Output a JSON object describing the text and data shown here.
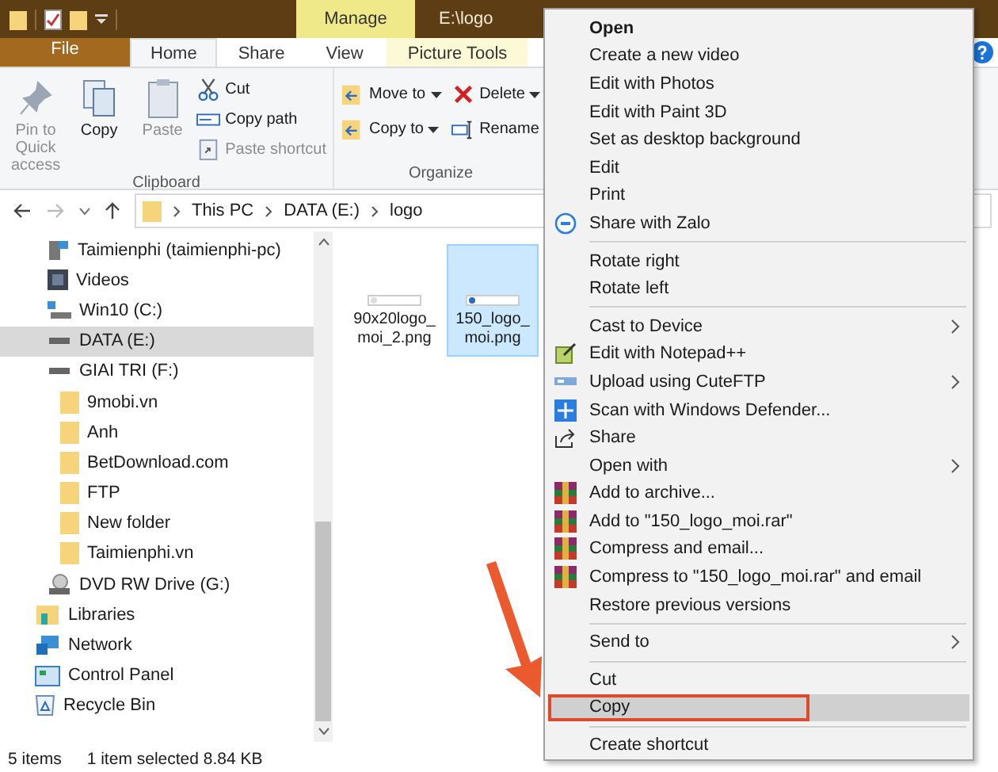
{
  "window": {
    "title": "E:\\logo",
    "context_tab": "Manage"
  },
  "tabs": [
    {
      "label": "File",
      "kind": "file",
      "selected": false
    },
    {
      "label": "Home",
      "kind": "normal",
      "selected": true
    },
    {
      "label": "Share",
      "kind": "normal",
      "selected": false
    },
    {
      "label": "View",
      "kind": "normal",
      "selected": false
    },
    {
      "label": "Picture Tools",
      "kind": "context",
      "selected": false
    }
  ],
  "ribbon": {
    "groups": [
      {
        "label": "Clipboard",
        "large_buttons": [
          {
            "label": "Pin to Quick access",
            "kind": "pin",
            "disabled": true
          },
          {
            "label": "Copy",
            "kind": "copy",
            "disabled": false
          },
          {
            "label": "Paste",
            "kind": "paste",
            "disabled": true
          }
        ],
        "small_buttons": [
          {
            "label": "Cut",
            "kind": "cut",
            "disabled": false,
            "dropdown": false
          },
          {
            "label": "Copy path",
            "kind": "copypath",
            "disabled": false,
            "dropdown": false
          },
          {
            "label": "Paste shortcut",
            "kind": "pasteshortcut",
            "disabled": true,
            "dropdown": false
          }
        ]
      },
      {
        "label": "Organize",
        "small_buttons": [
          {
            "label": "Move to",
            "kind": "moveto",
            "disabled": false,
            "dropdown": true
          },
          {
            "label": "Copy to",
            "kind": "copyto",
            "disabled": false,
            "dropdown": true
          },
          {
            "label": "Delete",
            "kind": "delete",
            "disabled": false,
            "dropdown": true
          },
          {
            "label": "Rename",
            "kind": "rename",
            "disabled": false,
            "dropdown": false
          }
        ]
      }
    ]
  },
  "address": {
    "path": [
      "This PC",
      "DATA (E:)",
      "logo"
    ]
  },
  "nav": {
    "items": [
      {
        "label": "Taimienphi (taimienphi-pc)",
        "kind": "netpc",
        "selected": false
      },
      {
        "label": "Videos",
        "kind": "videos",
        "selected": false
      },
      {
        "label": "Win10 (C:)",
        "kind": "windrive",
        "selected": false
      },
      {
        "label": "DATA (E:)",
        "kind": "drive",
        "selected": true
      },
      {
        "label": "GIAI TRI (F:)",
        "kind": "drive",
        "selected": false,
        "children": [
          {
            "label": "9mobi.vn",
            "kind": "folder",
            "selected": false
          },
          {
            "label": "Anh",
            "kind": "folder",
            "selected": false
          },
          {
            "label": "BetDownload.com",
            "kind": "folder",
            "selected": false
          },
          {
            "label": "FTP",
            "kind": "folder",
            "selected": false
          },
          {
            "label": "New folder",
            "kind": "folder",
            "selected": false
          },
          {
            "label": "Taimienphi.vn",
            "kind": "folder",
            "selected": false
          }
        ]
      },
      {
        "label": "DVD RW Drive (G:)",
        "kind": "dvd",
        "selected": false
      },
      {
        "label": "Libraries",
        "kind": "libraries",
        "selected": false
      },
      {
        "label": "Network",
        "kind": "network",
        "selected": false
      },
      {
        "label": "Control Panel",
        "kind": "controlpanel",
        "selected": false
      },
      {
        "label": "Recycle Bin",
        "kind": "recyclebin",
        "selected": false
      }
    ]
  },
  "files": [
    {
      "name": "90x20logo_moi_2.png",
      "selected": false
    },
    {
      "name": "150_logo_moi.png",
      "selected": true
    }
  ],
  "status_bar": {
    "count": "5 items",
    "selection": "1 item selected  8.84 KB"
  },
  "context_menu": {
    "groups": [
      [
        {
          "label": "Open",
          "kind": "plain",
          "default": true,
          "submenu": false,
          "selected": false,
          "highlighted": false
        },
        {
          "label": "Create a new video",
          "kind": "plain",
          "default": false,
          "submenu": false,
          "selected": false,
          "highlighted": false
        },
        {
          "label": "Edit with Photos",
          "kind": "plain",
          "default": false,
          "submenu": false,
          "selected": false,
          "highlighted": false
        },
        {
          "label": "Edit with Paint 3D",
          "kind": "plain",
          "default": false,
          "submenu": false,
          "selected": false,
          "highlighted": false
        },
        {
          "label": "Set as desktop background",
          "kind": "plain",
          "default": false,
          "submenu": false,
          "selected": false,
          "highlighted": false
        },
        {
          "label": "Edit",
          "kind": "plain",
          "default": false,
          "submenu": false,
          "selected": false,
          "highlighted": false
        },
        {
          "label": "Print",
          "kind": "plain",
          "default": false,
          "submenu": false,
          "selected": false,
          "highlighted": false
        },
        {
          "label": "Share with Zalo",
          "kind": "zalo",
          "default": false,
          "submenu": false,
          "selected": false,
          "highlighted": false
        }
      ],
      [
        {
          "label": "Rotate right",
          "kind": "plain",
          "default": false,
          "submenu": false,
          "selected": false,
          "highlighted": false
        },
        {
          "label": "Rotate left",
          "kind": "plain",
          "default": false,
          "submenu": false,
          "selected": false,
          "highlighted": false
        }
      ],
      [
        {
          "label": "Cast to Device",
          "kind": "plain",
          "default": false,
          "submenu": true,
          "selected": false,
          "highlighted": false
        },
        {
          "label": "Edit with Notepad++",
          "kind": "notepad",
          "default": false,
          "submenu": false,
          "selected": false,
          "highlighted": false
        },
        {
          "label": "Upload using CuteFTP",
          "kind": "ftp",
          "default": false,
          "submenu": true,
          "selected": false,
          "highlighted": false
        },
        {
          "label": "Scan with Windows Defender...",
          "kind": "defender",
          "default": false,
          "submenu": false,
          "selected": false,
          "highlighted": false
        },
        {
          "label": "Share",
          "kind": "share",
          "default": false,
          "submenu": false,
          "selected": false,
          "highlighted": false
        },
        {
          "label": "Open with",
          "kind": "plain",
          "default": false,
          "submenu": true,
          "selected": false,
          "highlighted": false
        },
        {
          "label": "Add to archive...",
          "kind": "rar",
          "default": false,
          "submenu": false,
          "selected": false,
          "highlighted": false
        },
        {
          "label": "Add to \"150_logo_moi.rar\"",
          "kind": "rar",
          "default": false,
          "submenu": false,
          "selected": false,
          "highlighted": false
        },
        {
          "label": "Compress and email...",
          "kind": "rar",
          "default": false,
          "submenu": false,
          "selected": false,
          "highlighted": false
        },
        {
          "label": "Compress to \"150_logo_moi.rar\" and email",
          "kind": "rar",
          "default": false,
          "submenu": false,
          "selected": false,
          "highlighted": false
        },
        {
          "label": "Restore previous versions",
          "kind": "plain",
          "default": false,
          "submenu": false,
          "selected": false,
          "highlighted": false
        }
      ],
      [
        {
          "label": "Send to",
          "kind": "plain",
          "default": false,
          "submenu": true,
          "selected": false,
          "highlighted": false
        }
      ],
      [
        {
          "label": "Cut",
          "kind": "plain",
          "default": false,
          "submenu": false,
          "selected": false,
          "highlighted": false
        },
        {
          "label": "Copy",
          "kind": "plain",
          "default": false,
          "submenu": false,
          "selected": true,
          "highlighted": true
        }
      ],
      [
        {
          "label": "Create shortcut",
          "kind": "plain",
          "default": false,
          "submenu": false,
          "selected": false,
          "highlighted": false
        }
      ]
    ]
  },
  "annotations": [
    {
      "kind": "arrow"
    }
  ]
}
